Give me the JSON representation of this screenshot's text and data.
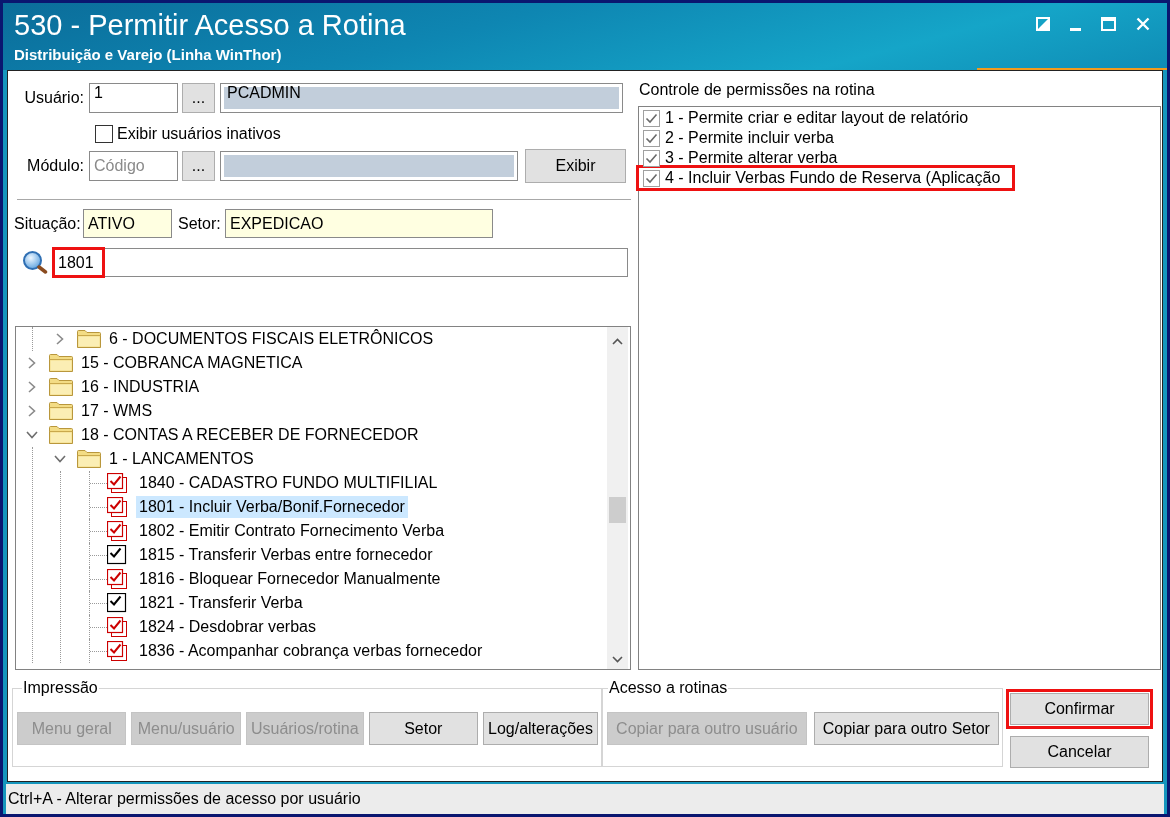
{
  "window": {
    "title": "530 - Permitir Acesso a Rotina",
    "subtitle": "Distribuição e Varejo (Linha WinThor)"
  },
  "user": {
    "label": "Usuário:",
    "code": "1",
    "browse_button": "...",
    "name": "PCADMIN"
  },
  "show_inactive": {
    "label": "Exibir usuários inativos",
    "checked": false
  },
  "module": {
    "label": "Módulo:",
    "placeholder": "Código",
    "browse_button": "...",
    "show_button": "Exibir"
  },
  "status": {
    "label": "Situação:",
    "value": "ATIVO"
  },
  "sector": {
    "label": "Setor:",
    "value": "EXPEDICAO"
  },
  "search": {
    "value": "1801",
    "highlighted": true
  },
  "tree": {
    "continued_children": [
      {
        "kind": "folder",
        "label": "6 - DOCUMENTOS FISCAIS ELETRÔNICOS",
        "expanded": false,
        "selected": false
      }
    ],
    "items": [
      {
        "kind": "folder",
        "label": "15 - COBRANCA MAGNETICA",
        "expanded": false,
        "selected": false
      },
      {
        "kind": "folder",
        "label": "16 - INDUSTRIA",
        "expanded": false,
        "selected": false
      },
      {
        "kind": "folder",
        "label": "17 - WMS",
        "expanded": false,
        "selected": false
      },
      {
        "kind": "folder",
        "label": "18 - CONTAS A RECEBER DE FORNECEDOR",
        "expanded": true,
        "selected": false,
        "children": [
          {
            "kind": "folder",
            "label": "1 - LANCAMENTOS",
            "expanded": true,
            "selected": false,
            "children": [
              {
                "kind": "routine",
                "label": "1840 - CADASTRO FUNDO MULTIFILIAL",
                "checked": true,
                "color": "#cc0000",
                "selected": false
              },
              {
                "kind": "routine",
                "label": "1801 - Incluir Verba/Bonif.Fornecedor",
                "checked": true,
                "color": "#cc0000",
                "selected": true
              },
              {
                "kind": "routine",
                "label": "1802 - Emitir Contrato Fornecimento Verba",
                "checked": true,
                "color": "#cc0000",
                "selected": false
              },
              {
                "kind": "routine",
                "label": "1815 - Transferir Verbas entre fornecedor",
                "checked": true,
                "color": "#000000",
                "selected": false
              },
              {
                "kind": "routine",
                "label": "1816 - Bloquear Fornecedor Manualmente",
                "checked": true,
                "color": "#cc0000",
                "selected": false
              },
              {
                "kind": "routine",
                "label": "1821 - Transferir Verba",
                "checked": true,
                "color": "#000000",
                "selected": false
              },
              {
                "kind": "routine",
                "label": "1824 - Desdobrar verbas",
                "checked": true,
                "color": "#cc0000",
                "selected": false
              },
              {
                "kind": "routine",
                "label": "1836 - Acompanhar cobrança verbas fornecedor",
                "checked": true,
                "color": "#cc0000",
                "selected": false
              }
            ]
          }
        ]
      }
    ]
  },
  "permissions": {
    "title": "Controle de permissões na rotina",
    "items": [
      {
        "label": "1 - Permite criar e editar layout de relatório",
        "checked": true,
        "highlighted": false
      },
      {
        "label": "2 - Permite incluir verba",
        "checked": true,
        "highlighted": false
      },
      {
        "label": "3 - Permite alterar verba",
        "checked": true,
        "highlighted": false
      },
      {
        "label": "4 - Incluir Verbas Fundo de Reserva (Aplicação",
        "checked": true,
        "highlighted": true
      }
    ]
  },
  "print_group": {
    "title": "Impressão",
    "buttons": [
      {
        "label": "Menu geral",
        "disabled": true
      },
      {
        "label": "Menu/usuário",
        "disabled": true
      },
      {
        "label": "Usuários/rotina",
        "disabled": true
      },
      {
        "label": "Setor",
        "disabled": false
      },
      {
        "label": "Log/alterações",
        "disabled": false
      }
    ]
  },
  "access_group": {
    "title": "Acesso a rotinas",
    "buttons": [
      {
        "label": "Copiar para outro usuário",
        "disabled": true
      },
      {
        "label": "Copiar para outro Setor",
        "disabled": false
      }
    ]
  },
  "actions": [
    {
      "label": "Confirmar",
      "highlighted": true
    },
    {
      "label": "Cancelar",
      "highlighted": false
    }
  ],
  "status_bar": {
    "text": "Ctrl+A - Alterar permissões de acesso por usuário"
  }
}
